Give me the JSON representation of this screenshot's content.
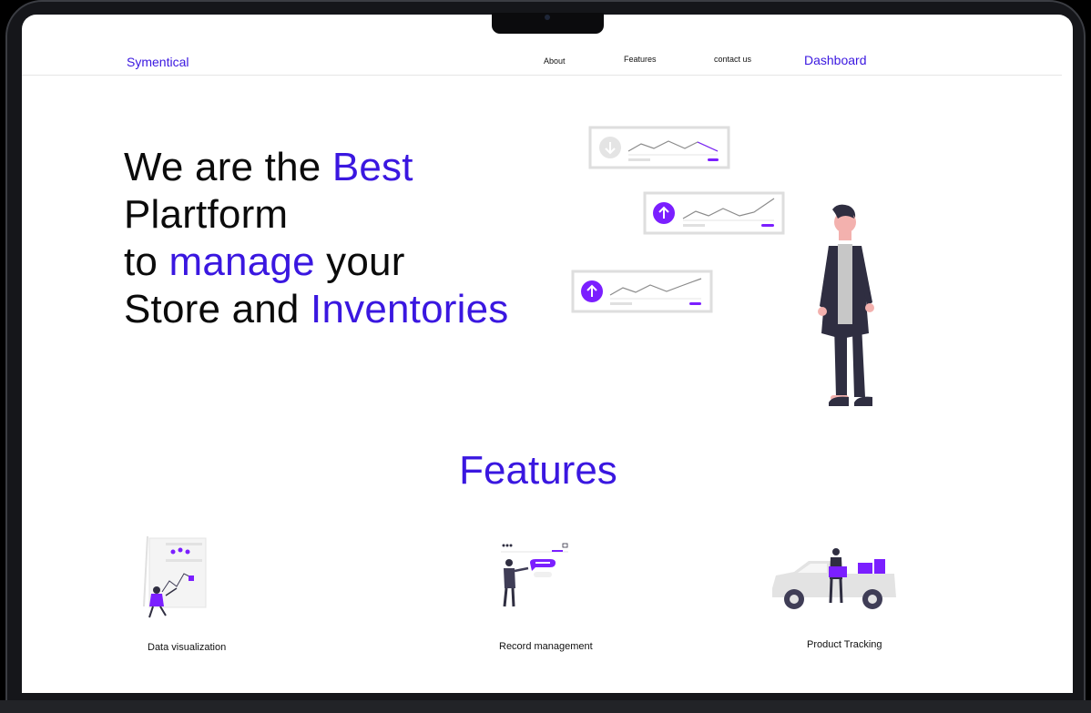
{
  "nav": {
    "brand": "Symentical",
    "links": [
      "About",
      "Features",
      "contact us"
    ],
    "dashboard": "Dashboard"
  },
  "hero": {
    "line1_a": "We are the ",
    "line1_b": "Best",
    "line2": "Plartform",
    "line3_a": "to ",
    "line3_b": "manage",
    "line3_c": " your",
    "line4_a": "Store and ",
    "line4_b": "Inventories"
  },
  "features": {
    "title": "Features",
    "items": [
      {
        "label": "Data visualization"
      },
      {
        "label": "Record management"
      },
      {
        "label": "Product Tracking"
      }
    ]
  },
  "colors": {
    "accent": "#3a17e0",
    "illustration_purple": "#7b1fff",
    "bezel": "#15161a"
  },
  "icons": [
    "arrow-down-icon",
    "arrow-up-icon",
    "person-illustration",
    "car-illustration"
  ]
}
